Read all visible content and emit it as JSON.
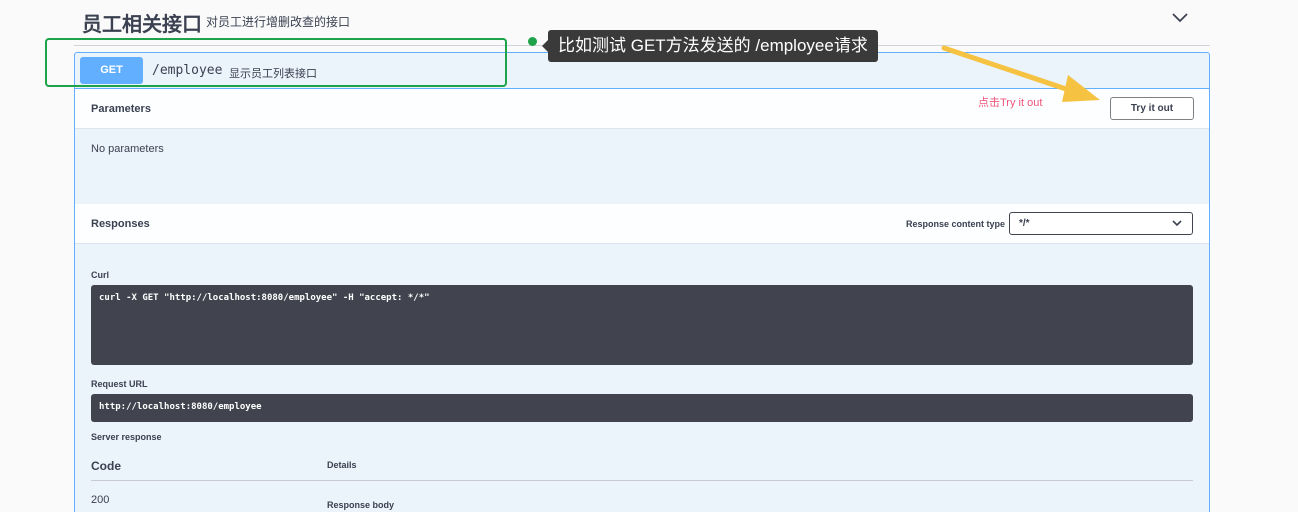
{
  "tag": {
    "title": "员工相关接口",
    "description": "对员工进行增删改查的接口"
  },
  "annotation": {
    "callout": "比如测试 GET方法发送的 /employee请求",
    "hint": "点击Try it out",
    "colors": {
      "box": "#1fa34a",
      "arrow": "#f5c242",
      "hint": "#f1547a"
    }
  },
  "operation": {
    "method": "GET",
    "path": "/employee",
    "summary": "显示员工列表接口",
    "method_color": "#61affe"
  },
  "parameters": {
    "title": "Parameters",
    "try_it_out": "Try it out",
    "empty_text": "No parameters"
  },
  "responses": {
    "title": "Responses",
    "content_type_label": "Response content type",
    "content_type_value": "*/*",
    "curl_label": "Curl",
    "curl_command": "curl -X GET \"http://localhost:8080/employee\" -H \"accept: */*\"",
    "request_url_label": "Request URL",
    "request_url": "http://localhost:8080/employee",
    "server_response_label": "Server response",
    "table": {
      "code_header": "Code",
      "details_header": "Details",
      "rows": [
        {
          "code": "200",
          "body_label": "Response body"
        }
      ]
    }
  }
}
